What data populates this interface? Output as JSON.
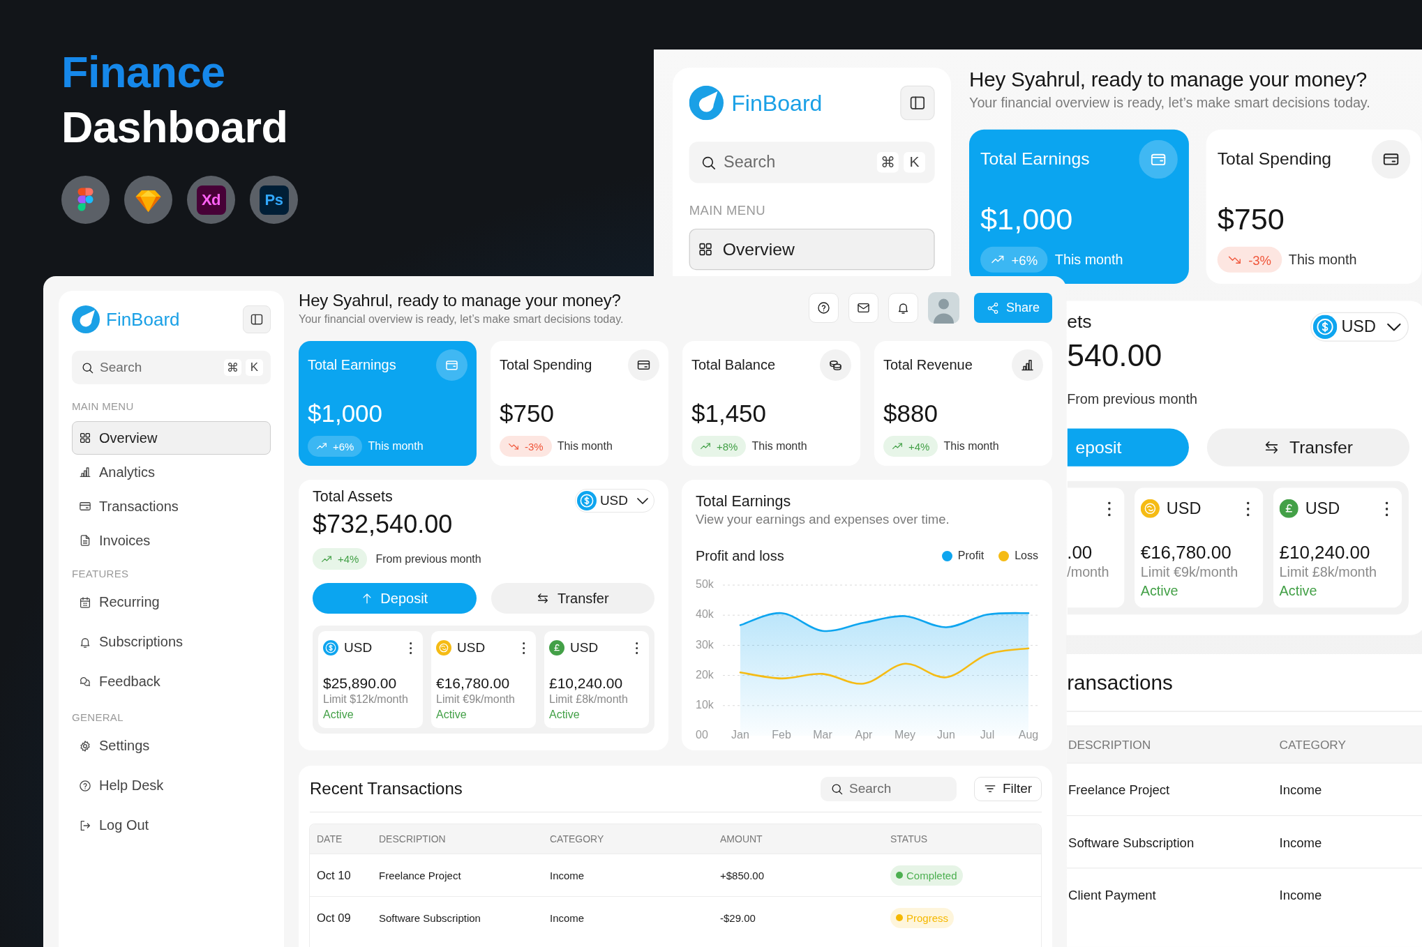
{
  "hero": {
    "headline_accent": "Finance",
    "headline": "Dashboard",
    "tools": [
      {
        "kind": "figma"
      },
      {
        "kind": "sketch"
      },
      {
        "kind": "xd",
        "label": "Xd"
      },
      {
        "kind": "ps",
        "label": "Ps"
      }
    ]
  },
  "back_window": {
    "sidebar": {
      "brand": "FinBoard",
      "search": {
        "placeholder": "Search",
        "shortcut": [
          "⌘",
          "K"
        ]
      },
      "sections": [
        {
          "heading": "MAIN MENU",
          "items": [
            {
              "label": "Overview",
              "kind": "grid",
              "selected": true
            }
          ]
        }
      ]
    },
    "header": {
      "greeting": "Hey Syahrul, ready to manage your money?",
      "subtitle": "Your financial overview is ready, let’s make smart decisions today."
    },
    "stats": [
      {
        "title": "Total Earnings",
        "kind": "wallet",
        "value": "$1,000",
        "change": "+6%",
        "trend_up": true,
        "period": "This month",
        "highlighted": true
      },
      {
        "title": "Total Spending",
        "kind": "card",
        "value": "$750",
        "change": "-3%",
        "trend_up": false,
        "period": "This month",
        "highlighted": false
      }
    ],
    "assets": {
      "title": "ets",
      "currency": "USD",
      "total": "540.00",
      "note": "From previous month",
      "deposit": "eposit",
      "transfer": "Transfer",
      "accounts": [
        {
          "amount": ".00",
          "limit": "/month"
        },
        {
          "kind": "euro",
          "currency": "USD",
          "amount": "€16,780.00",
          "limit": "Limit €9k/month",
          "status": "Active"
        },
        {
          "kind": "pound",
          "currency": "USD",
          "amount": "£10,240.00",
          "limit": "Limit £8k/month",
          "status": "Active"
        }
      ]
    },
    "transactions": {
      "title": "ransactions",
      "columns": [
        "DESCRIPTION",
        "CATEGORY"
      ],
      "rows": [
        {
          "description": "Freelance Project",
          "category": "Income"
        },
        {
          "description": "Software Subscription",
          "category": "Income"
        },
        {
          "description": "Client Payment",
          "category": "Income"
        }
      ]
    }
  },
  "front_window": {
    "sidebar": {
      "brand": "FinBoard",
      "search": {
        "placeholder": "Search",
        "shortcut": [
          "⌘",
          "K"
        ]
      },
      "sections": [
        {
          "heading": "MAIN MENU",
          "items": [
            {
              "label": "Overview",
              "kind": "grid",
              "selected": true
            },
            {
              "label": "Analytics",
              "kind": "bars",
              "selected": false
            },
            {
              "label": "Transactions",
              "kind": "card",
              "selected": false
            },
            {
              "label": "Invoices",
              "kind": "document",
              "selected": false
            }
          ]
        },
        {
          "heading": "FEATURES",
          "items": [
            {
              "label": "Recurring",
              "kind": "calendar",
              "selected": false
            },
            {
              "label": "Subscriptions",
              "kind": "bell",
              "selected": false
            },
            {
              "label": "Feedback",
              "kind": "chat",
              "selected": false
            }
          ]
        },
        {
          "heading": "GENERAL",
          "items": [
            {
              "label": "Settings",
              "kind": "gear",
              "selected": false
            },
            {
              "label": "Help Desk",
              "kind": "help",
              "selected": false
            },
            {
              "label": "Log Out",
              "kind": "logout",
              "selected": false
            }
          ]
        }
      ]
    },
    "header": {
      "greeting": "Hey Syahrul, ready to manage your money?",
      "subtitle": "Your financial overview is ready, let’s make smart decisions today.",
      "actions": [
        {
          "kind": "help"
        },
        {
          "kind": "mail"
        },
        {
          "kind": "bell"
        }
      ],
      "share": "Share"
    },
    "stats": [
      {
        "title": "Total Earnings",
        "kind": "wallet",
        "value": "$1,000",
        "change": "+6%",
        "trend_up": true,
        "period": "This month",
        "highlighted": true
      },
      {
        "title": "Total Spending",
        "kind": "card",
        "value": "$750",
        "change": "-3%",
        "trend_up": false,
        "period": "This month",
        "highlighted": false
      },
      {
        "title": "Total Balance",
        "kind": "coins",
        "value": "$1,450",
        "change": "+8%",
        "trend_up": true,
        "period": "This month",
        "highlighted": false
      },
      {
        "title": "Total Revenue",
        "kind": "bars",
        "value": "$880",
        "change": "+4%",
        "trend_up": true,
        "period": "This month",
        "highlighted": false
      }
    ],
    "assets": {
      "title": "Total Assets",
      "currency": "USD",
      "total": "$732,540.00",
      "change": "+4%",
      "trend_up": true,
      "note": "From previous month",
      "deposit": "Deposit",
      "transfer": "Transfer",
      "accounts": [
        {
          "kind": "dollar",
          "currency": "USD",
          "amount": "$25,890.00",
          "limit": "Limit $12k/month",
          "status": "Active"
        },
        {
          "kind": "euro",
          "currency": "USD",
          "amount": "€16,780.00",
          "limit": "Limit €9k/month",
          "status": "Active"
        },
        {
          "kind": "pound",
          "currency": "USD",
          "amount": "£10,240.00",
          "limit": "Limit £8k/month",
          "status": "Active"
        }
      ]
    },
    "earnings_chart": {
      "title": "Total Earnings",
      "subtitle": "View your earnings and expenses over time.",
      "chart_data": {
        "type": "line",
        "title": "Profit and loss",
        "grid": true,
        "categories": [
          "Jan",
          "Feb",
          "Mar",
          "Apr",
          "Mey",
          "Jun",
          "Jul",
          "Aug"
        ],
        "series": [
          {
            "name": "Profit",
            "type": "area",
            "color": "#0ea5ef",
            "values": [
              36700,
              40700,
              34800,
              37500,
              39700,
              36000,
              40200,
              40700
            ]
          },
          {
            "name": "Loss",
            "type": "line",
            "color": "#f5bb14",
            "values": [
              21000,
              19000,
              20500,
              17300,
              23900,
              19400,
              27000,
              29000
            ]
          }
        ],
        "ylim": [
          0,
          50000
        ],
        "yticks": [
          {
            "value": 0,
            "label": "00"
          },
          {
            "value": 10000,
            "label": "10k"
          },
          {
            "value": 20000,
            "label": "20k"
          },
          {
            "value": 30000,
            "label": "30k"
          },
          {
            "value": 40000,
            "label": "40k"
          },
          {
            "value": 50000,
            "label": "50k"
          }
        ]
      }
    },
    "transactions": {
      "title": "Recent Transactions",
      "search": {
        "placeholder": "Search"
      },
      "filter": "Filter",
      "columns": [
        "DATE",
        "DESCRIPTION",
        "CATEGORY",
        "AMOUNT",
        "STATUS"
      ],
      "rows": [
        {
          "date": "Oct 10",
          "description": "Freelance Project",
          "category": "Income",
          "amount": "+$850.00",
          "status": {
            "label": "Completed",
            "color": "#4caf50"
          }
        },
        {
          "date": "Oct 09",
          "description": "Software Subscription",
          "category": "Income",
          "amount": "-$29.00",
          "status": {
            "label": "Progress",
            "color": "#f5b800"
          }
        }
      ]
    }
  }
}
